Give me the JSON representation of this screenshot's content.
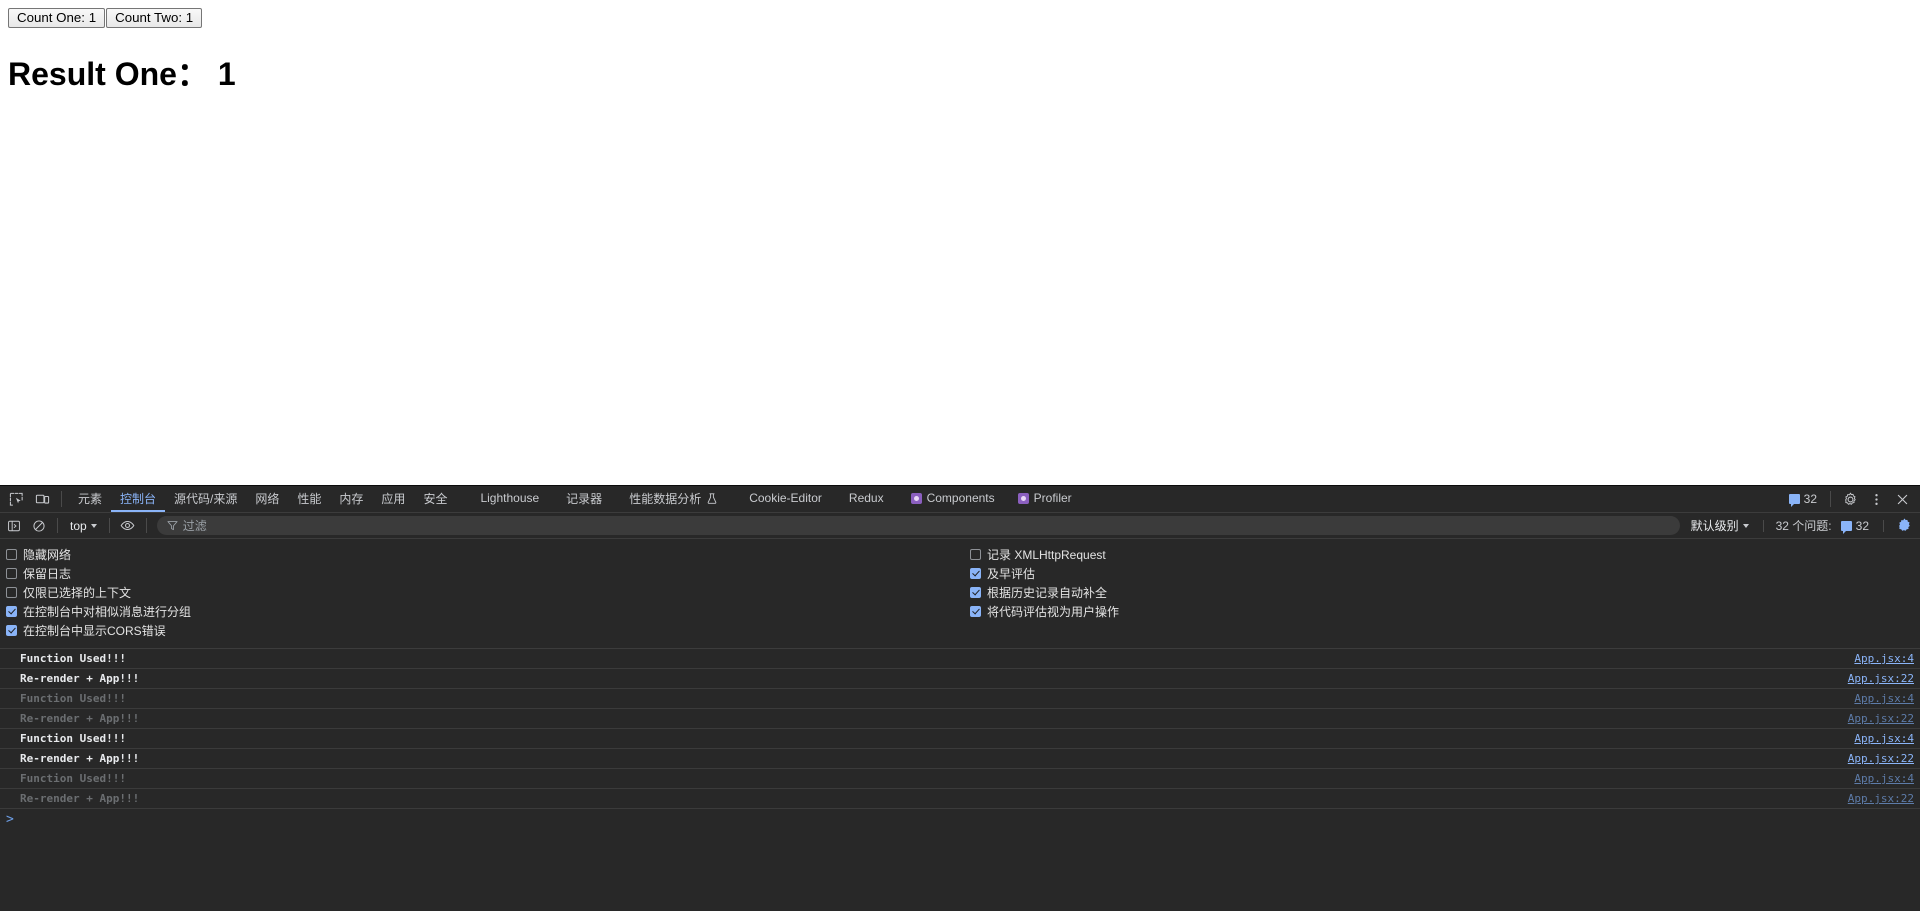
{
  "page": {
    "buttons": [
      {
        "label": "Count One: 1",
        "name": "count-one-button"
      },
      {
        "label": "Count Two: 1",
        "name": "count-two-button"
      }
    ],
    "heading": "Result One： 1"
  },
  "devtools": {
    "tabs": [
      {
        "label": "元素",
        "active": false,
        "icon": null
      },
      {
        "label": "控制台",
        "active": true,
        "icon": null
      },
      {
        "label": "源代码/来源",
        "active": false,
        "icon": null
      },
      {
        "label": "网络",
        "active": false,
        "icon": null
      },
      {
        "label": "性能",
        "active": false,
        "icon": null
      },
      {
        "label": "内存",
        "active": false,
        "icon": null
      },
      {
        "label": "应用",
        "active": false,
        "icon": null
      },
      {
        "label": "安全",
        "active": false,
        "icon": null
      },
      {
        "label": "Lighthouse",
        "active": false,
        "icon": null
      },
      {
        "label": "记录器",
        "active": false,
        "icon": null
      },
      {
        "label": "性能数据分析",
        "active": false,
        "icon": "flask-icon"
      },
      {
        "label": "Cookie-Editor",
        "active": false,
        "icon": null
      },
      {
        "label": "Redux",
        "active": false,
        "icon": null
      },
      {
        "label": "Components",
        "active": false,
        "icon": "react-icon"
      },
      {
        "label": "Profiler",
        "active": false,
        "icon": "react-icon"
      }
    ],
    "tabbar_right": {
      "message_count": "32",
      "settings_tooltip": "gear-icon",
      "more_tooltip": "more-options-icon",
      "close_tooltip": "close-icon"
    },
    "console_toolbar": {
      "context": "top",
      "filter_placeholder": "过滤",
      "level": "默认级别",
      "issues_label": "32 个问题:",
      "issues_count": "32"
    },
    "settings_left": [
      {
        "label": "隐藏网络",
        "checked": false
      },
      {
        "label": "保留日志",
        "checked": false
      },
      {
        "label": "仅限已选择的上下文",
        "checked": false
      },
      {
        "label": "在控制台中对相似消息进行分组",
        "checked": true
      },
      {
        "label": "在控制台中显示CORS错误",
        "checked": true
      }
    ],
    "settings_right": [
      {
        "label": "记录 XMLHttpRequest",
        "checked": false
      },
      {
        "label": "及早评估",
        "checked": true
      },
      {
        "label": "根据历史记录自动补全",
        "checked": true
      },
      {
        "label": "将代码评估视为用户操作",
        "checked": true
      }
    ],
    "logs": [
      {
        "text": "Function Used!!!",
        "source": "App.jsx:4",
        "dim": false
      },
      {
        "text": "Re-render + App!!!",
        "source": "App.jsx:22",
        "dim": false
      },
      {
        "text": "Function Used!!!",
        "source": "App.jsx:4",
        "dim": true
      },
      {
        "text": "Re-render + App!!!",
        "source": "App.jsx:22",
        "dim": true
      },
      {
        "text": "Function Used!!!",
        "source": "App.jsx:4",
        "dim": false
      },
      {
        "text": "Re-render + App!!!",
        "source": "App.jsx:22",
        "dim": false
      },
      {
        "text": "Function Used!!!",
        "source": "App.jsx:4",
        "dim": true
      },
      {
        "text": "Re-render + App!!!",
        "source": "App.jsx:22",
        "dim": true
      }
    ],
    "prompt": ">"
  },
  "colors": {
    "accent": "#8ab4f8",
    "devtools_bg": "#282828",
    "react_purple": "#8b5fbf"
  }
}
